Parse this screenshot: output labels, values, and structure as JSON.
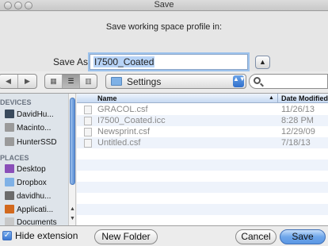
{
  "window": {
    "title": "Save"
  },
  "header": {
    "message": "Save working space profile in:",
    "save_as_label": "Save As:",
    "save_as_value": "I7500_Coated",
    "disclosure_symbol": "▲"
  },
  "toolbar": {
    "back_symbol": "◀",
    "forward_symbol": "▶",
    "view_icon_symbol": "▦",
    "view_list_symbol": "☰",
    "view_column_symbol": "▥",
    "location": "Settings",
    "popup_arrows": "▲▼"
  },
  "sidebar": {
    "scroll_up": "▲",
    "scroll_down": "▼",
    "sections": [
      {
        "title": "DEVICES",
        "items": [
          {
            "label": "DavidHu...",
            "icon": "laptop-icon",
            "color": "#3a4a5c"
          },
          {
            "label": "Macinto...",
            "icon": "hard-drive-icon",
            "color": "#9a9a9a"
          },
          {
            "label": "HunterSSD",
            "icon": "hard-drive-icon",
            "color": "#9a9a9a"
          }
        ]
      },
      {
        "title": "PLACES",
        "items": [
          {
            "label": "Desktop",
            "icon": "desktop-icon",
            "color": "#8a4fb8"
          },
          {
            "label": "Dropbox",
            "icon": "folder-icon",
            "color": "#7fb1e6"
          },
          {
            "label": "davidhu...",
            "icon": "home-icon",
            "color": "#6b6b6b"
          },
          {
            "label": "Applicati...",
            "icon": "applications-icon",
            "color": "#d2691e"
          },
          {
            "label": "Documents",
            "icon": "documents-icon",
            "color": "#c8c8c8"
          }
        ]
      }
    ]
  },
  "file_list": {
    "columns": {
      "name": "Name",
      "sort_indicator": "▲",
      "date": "Date Modified"
    },
    "rows": [
      {
        "name": "GRACOL.csf",
        "date": "11/26/13"
      },
      {
        "name": "I7500_Coated.icc",
        "date": "8:28 PM"
      },
      {
        "name": "Newsprint.csf",
        "date": "12/29/09"
      },
      {
        "name": "Untitled.csf",
        "date": "7/18/13"
      }
    ]
  },
  "bottom": {
    "hide_extension_checked": true,
    "check_symbol": "✓",
    "hide_extension_label": "Hide extension",
    "new_folder_label": "New Folder",
    "cancel_label": "Cancel",
    "save_label": "Save"
  }
}
